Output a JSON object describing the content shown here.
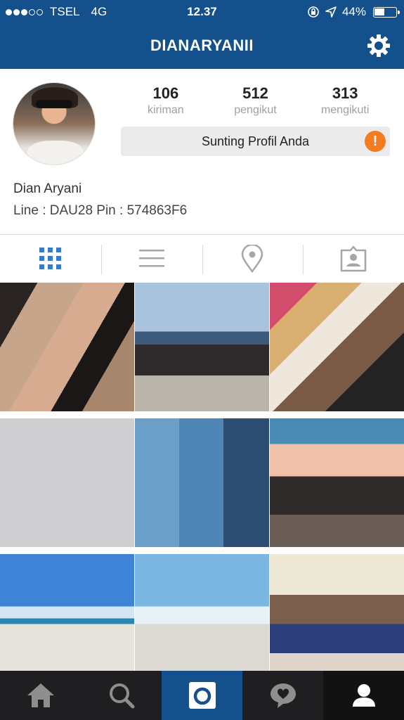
{
  "status_bar": {
    "carrier": "TSEL",
    "network": "4G",
    "time": "12.37",
    "battery": "44%",
    "signal_bars_filled": 3,
    "signal_bars_total": 5
  },
  "header": {
    "title": "DIANARYANII",
    "settings_icon": "gear-icon"
  },
  "profile": {
    "stats": [
      {
        "value": "106",
        "label": "kiriman"
      },
      {
        "value": "512",
        "label": "pengikut"
      },
      {
        "value": "313",
        "label": "mengikuti"
      }
    ],
    "edit_button": "Sunting Profil Anda",
    "alert_symbol": "!",
    "name": "Dian Aryani",
    "bio": "Line : DAU28 Pin : 574863F6"
  },
  "view_tabs": [
    {
      "icon": "grid-icon",
      "active": true
    },
    {
      "icon": "list-icon",
      "active": false
    },
    {
      "icon": "location-pin-icon",
      "active": false
    },
    {
      "icon": "tagged-person-icon",
      "active": false
    }
  ],
  "photos": [
    {
      "description": "selfie"
    },
    {
      "description": "group on beach"
    },
    {
      "description": "friends selfie"
    },
    {
      "description": "loading placeholder"
    },
    {
      "description": "collage"
    },
    {
      "description": "group barbecue"
    },
    {
      "description": "beach pose"
    },
    {
      "description": "beach jump"
    },
    {
      "description": "two friends"
    }
  ],
  "bottom_nav": [
    {
      "icon": "home-icon"
    },
    {
      "icon": "search-icon"
    },
    {
      "icon": "camera-icon"
    },
    {
      "icon": "activity-heart-icon"
    },
    {
      "icon": "profile-icon"
    }
  ],
  "colors": {
    "brand": "#14508b",
    "alert": "#f47b20",
    "tab_active": "#3a7cc4"
  }
}
